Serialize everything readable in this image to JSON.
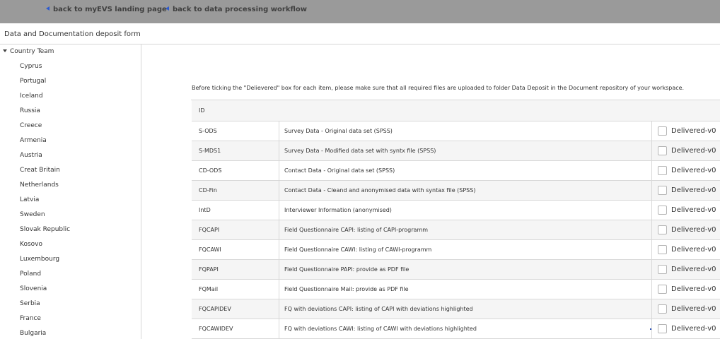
{
  "topbar": {
    "link_landing": "back to myEVS landing page",
    "link_workflow": "back to data processing workflow"
  },
  "form": {
    "title": "Data and Documentation deposit form"
  },
  "sidebar": {
    "root_label": "Country Team",
    "countries": [
      "Cyprus",
      "Portugal",
      "Iceland",
      "Russia",
      "Creece",
      "Armenia",
      "Austria",
      "Creat Britain",
      "Netherlands",
      "Latvia",
      "Sweden",
      "Slovak Republic",
      "Kosovo",
      "Luxembourg",
      "Poland",
      "Slovenia",
      "Serbia",
      "France",
      "Bulgaria"
    ]
  },
  "main": {
    "note": "Before ticking the \"Delievered\" box for each item, please make sure that all required files are uploaded to folder Data Deposit in the Document repository of your workspace.",
    "table_header_id": "ID",
    "rows": [
      {
        "id": "S-ODS",
        "description": "Survey Data - Original data set (SPSS)",
        "delivered": "Delivered-v0"
      },
      {
        "id": "S-MDS1",
        "description": "Survey Data - Modified data set with syntx file (SPSS)",
        "delivered": "Delivered-v0"
      },
      {
        "id": "CD-ODS",
        "description": "Contact Data - Original data set (SPSS)",
        "delivered": "Delivered-v0"
      },
      {
        "id": "CD-Fin",
        "description": "Contact Data - Cleand and anonymised data with syntax file (SPSS)",
        "delivered": "Delivered-v0"
      },
      {
        "id": "IntD",
        "description": "Interviewer Information (anonymised)",
        "delivered": "Delivered-v0"
      },
      {
        "id": "FQCAPI",
        "description": "Field Questionnaire CAPI: listing of CAPI-programm",
        "delivered": "Delivered-v0"
      },
      {
        "id": "FQCAWI",
        "description": "Field Questionnaire CAWI: listing of CAWI-programm",
        "delivered": "Delivered-v0"
      },
      {
        "id": "FQPAPI",
        "description": "Field Questionnaire PAPI: provide as PDF file",
        "delivered": "Delivered-v0"
      },
      {
        "id": "FQMail",
        "description": "Field Questionnaire Mail: provide as PDF file",
        "delivered": "Delivered-v0"
      },
      {
        "id": "FQCAPIDEV",
        "description": "FQ with deviations CAPI: listing of CAPI with deviations highlighted",
        "delivered": "Delivered-v0"
      },
      {
        "id": "FQCAWIDEV",
        "description": "FQ with deviations CAWI: listing of CAWI with deviations highlighted",
        "delivered": "Delivered-v0"
      }
    ]
  },
  "colors": {
    "topbar_bg": "#9a9a9a",
    "link_arrow": "#2d5bd0",
    "row_alt_bg": "#f5f5f5",
    "border": "#d8d8d8"
  },
  "icons": {
    "back_arrow": "triangle-left-icon",
    "tree_toggle": "caret-down-icon",
    "checkbox": "checkbox-icon"
  }
}
